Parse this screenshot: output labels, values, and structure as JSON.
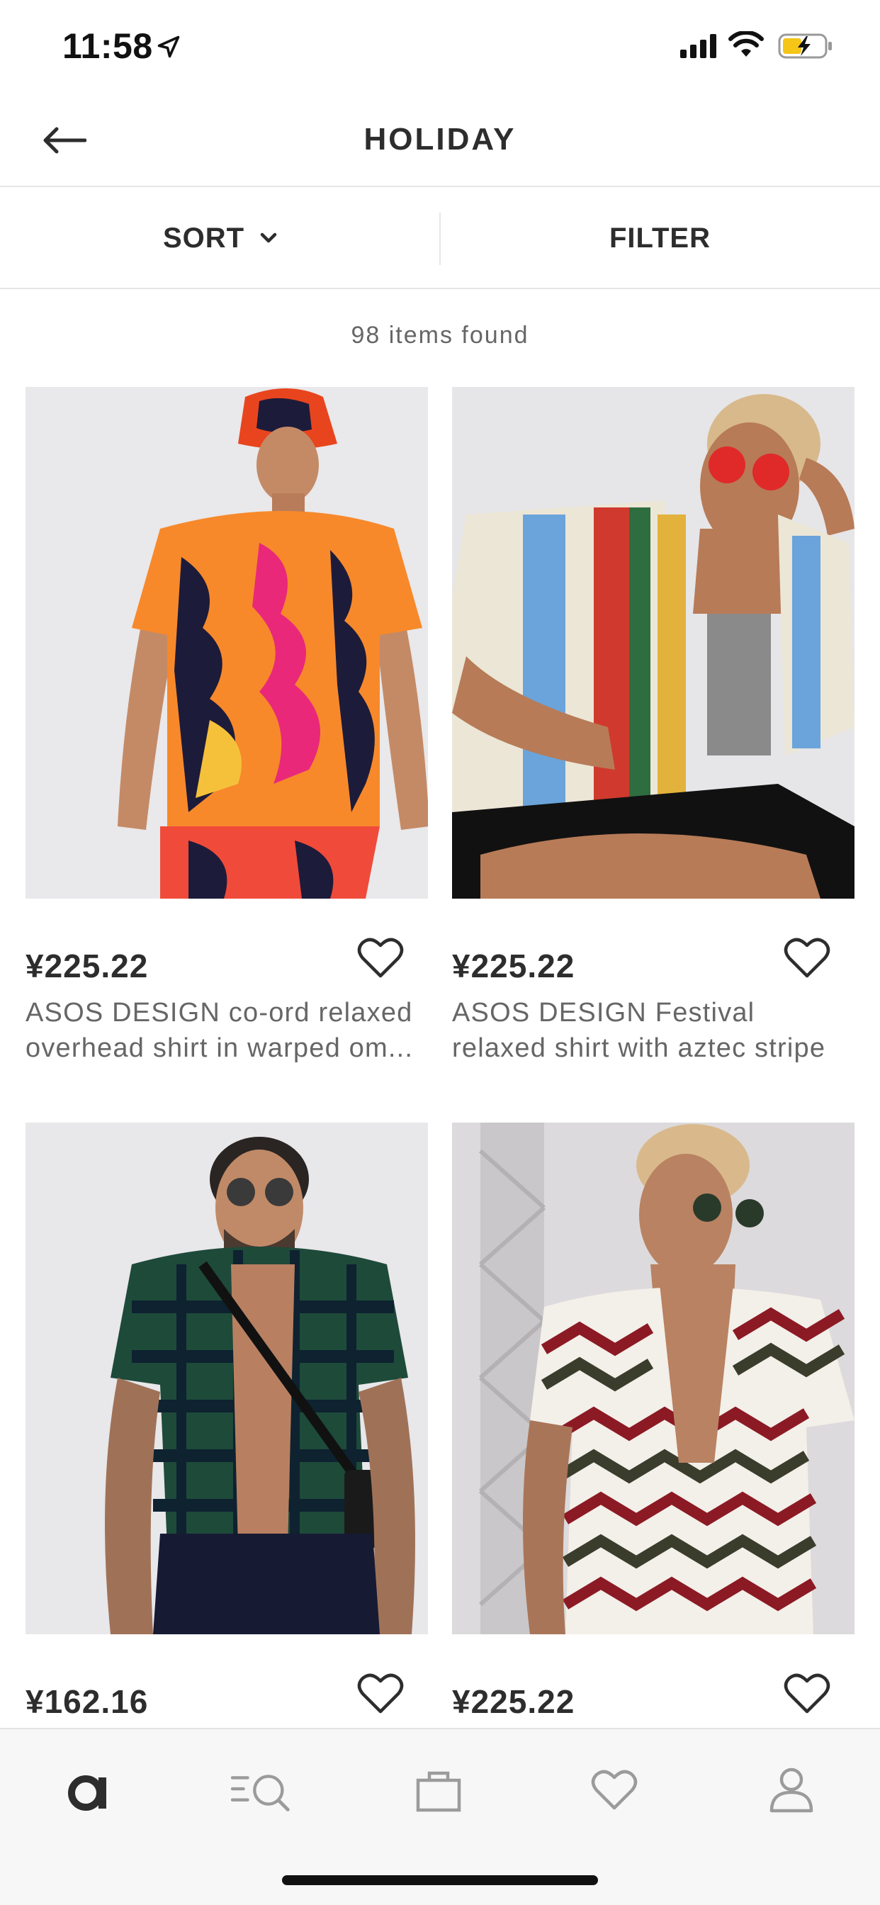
{
  "status_bar": {
    "time": "11:58"
  },
  "header": {
    "title": "HOLIDAY"
  },
  "toolbar": {
    "sort_label": "SORT",
    "filter_label": "FILTER"
  },
  "results": {
    "count_text": "98 items found"
  },
  "products": [
    {
      "price": "¥225.22",
      "description": "ASOS DESIGN co-ord relaxed overhead shirt in warped om..."
    },
    {
      "price": "¥225.22",
      "description": "ASOS DESIGN Festival relaxed shirt with aztec stripe"
    },
    {
      "price": "¥162.16",
      "description": ""
    },
    {
      "price": "¥225.22",
      "description": ""
    }
  ],
  "bottom_nav": {
    "items": [
      "home-logo-icon",
      "search-icon",
      "bag-icon",
      "saved-heart-icon",
      "account-icon"
    ]
  },
  "colors": {
    "text": "#2d2d2d",
    "muted": "#666666",
    "divider": "#e6e6e6",
    "nav_bg": "#f7f7f7"
  }
}
